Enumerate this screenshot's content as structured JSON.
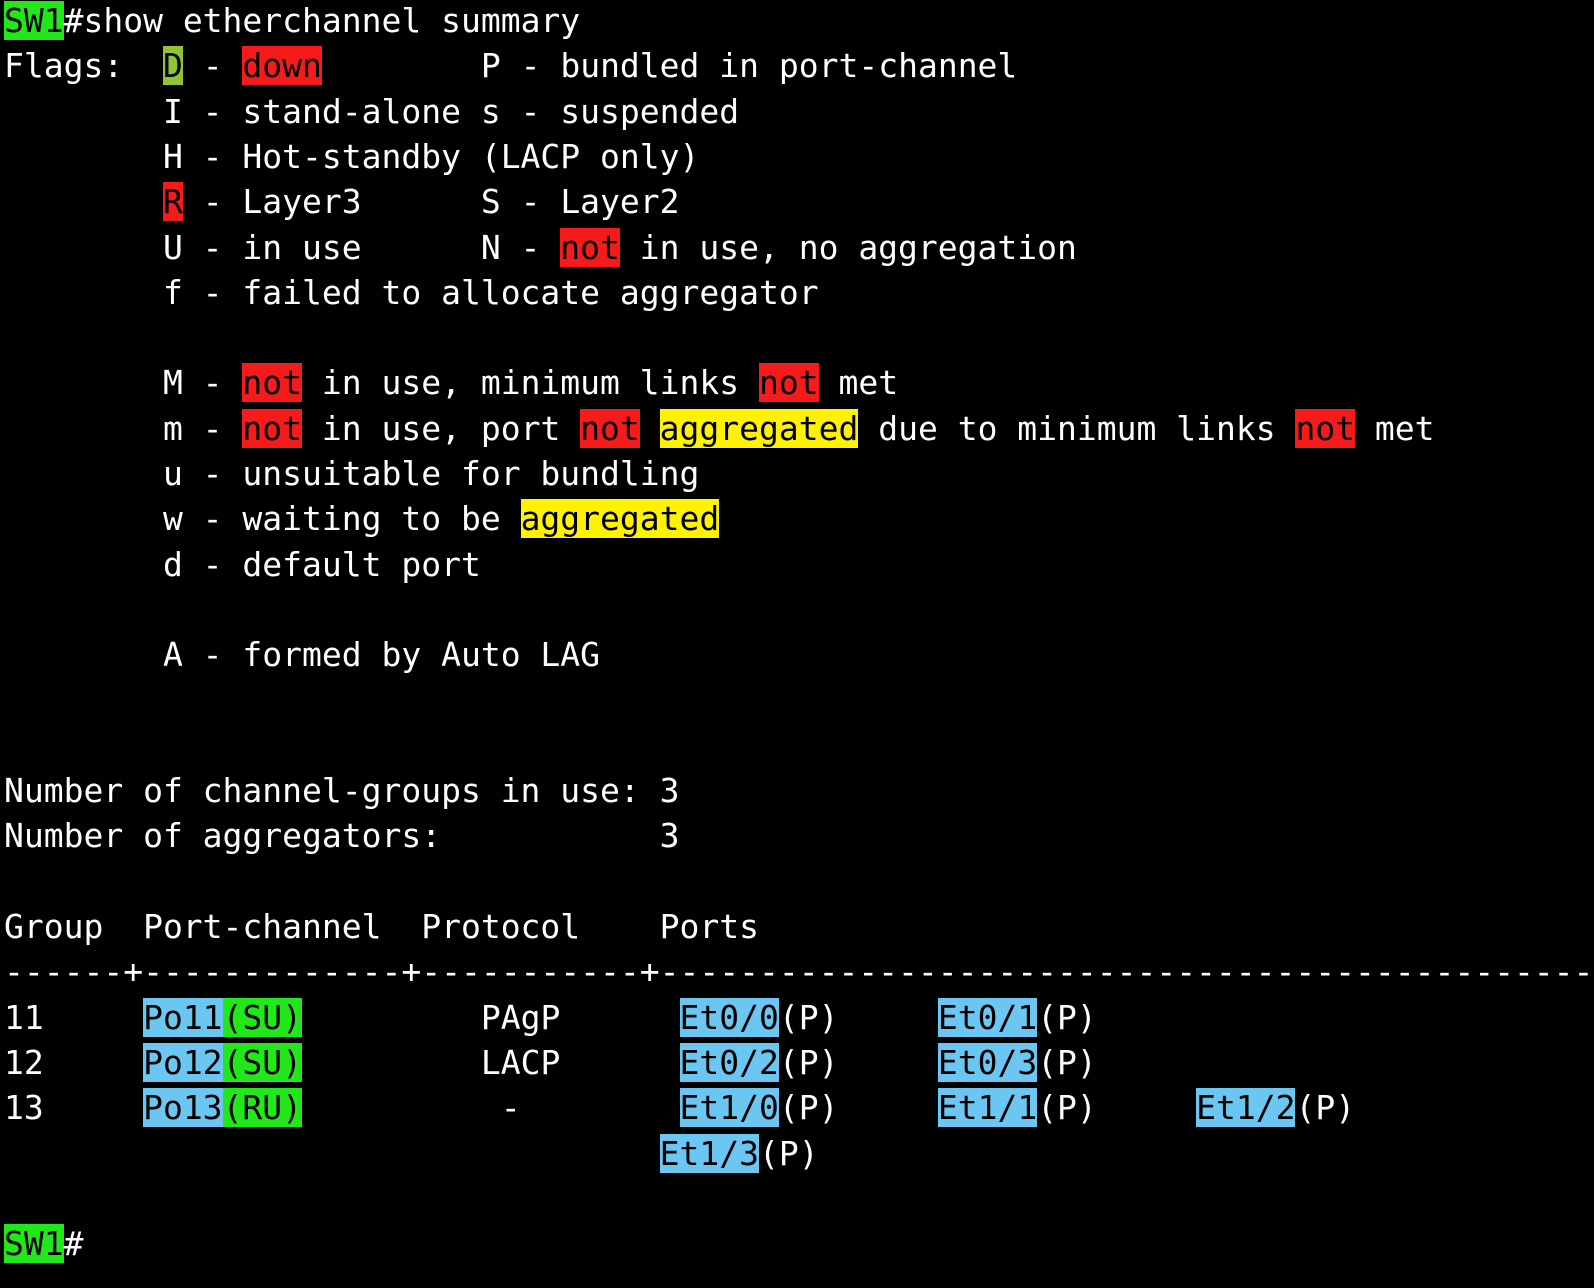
{
  "terminal": {
    "background": "#000000",
    "foreground": "#ffffff",
    "highlight_colors": {
      "green": "#22e81b",
      "olive": "#8fc435",
      "red": "#f51b1b",
      "yellow": "#fdf200",
      "blue": "#6bc7f2"
    },
    "lines": [
      {
        "name": "command-line",
        "segments": [
          {
            "t": "SW1",
            "hl": "green"
          },
          {
            "t": "#show etherchannel summary"
          }
        ]
      },
      {
        "name": "flags-line",
        "segments": [
          {
            "t": "Flags:  "
          },
          {
            "t": "D",
            "hl": "olive"
          },
          {
            "t": " - "
          },
          {
            "t": "down",
            "hl": "red"
          },
          {
            "t": "        P - bundled in port-channel"
          }
        ]
      },
      {
        "name": "flags-line",
        "segments": [
          {
            "t": "        I - stand-alone s - suspended"
          }
        ]
      },
      {
        "name": "flags-line",
        "segments": [
          {
            "t": "        H - Hot-standby (LACP only)"
          }
        ]
      },
      {
        "name": "flags-line",
        "segments": [
          {
            "t": "        "
          },
          {
            "t": "R",
            "hl": "red"
          },
          {
            "t": " - Layer3      S - Layer2"
          }
        ]
      },
      {
        "name": "flags-line",
        "segments": [
          {
            "t": "        U - in use      N - "
          },
          {
            "t": "not",
            "hl": "red"
          },
          {
            "t": " in use, no aggregation"
          }
        ]
      },
      {
        "name": "flags-line",
        "segments": [
          {
            "t": "        f - failed to allocate aggregator"
          }
        ]
      },
      {
        "name": "blank-line",
        "segments": []
      },
      {
        "name": "flags-line",
        "segments": [
          {
            "t": "        M - "
          },
          {
            "t": "not",
            "hl": "red"
          },
          {
            "t": " in use, minimum links "
          },
          {
            "t": "not",
            "hl": "red"
          },
          {
            "t": " met"
          }
        ]
      },
      {
        "name": "flags-line",
        "segments": [
          {
            "t": "        m - "
          },
          {
            "t": "not",
            "hl": "red"
          },
          {
            "t": " in use, port "
          },
          {
            "t": "not",
            "hl": "red"
          },
          {
            "t": " "
          },
          {
            "t": "aggregated",
            "hl": "yellow"
          },
          {
            "t": " due to minimum links "
          },
          {
            "t": "not",
            "hl": "red"
          },
          {
            "t": " met"
          }
        ]
      },
      {
        "name": "flags-line",
        "segments": [
          {
            "t": "        u - unsuitable for bundling"
          }
        ]
      },
      {
        "name": "flags-line",
        "segments": [
          {
            "t": "        w - waiting to be "
          },
          {
            "t": "aggregated",
            "hl": "yellow"
          }
        ]
      },
      {
        "name": "flags-line",
        "segments": [
          {
            "t": "        d - default port"
          }
        ]
      },
      {
        "name": "blank-line",
        "segments": []
      },
      {
        "name": "flags-line",
        "segments": [
          {
            "t": "        A - formed by Auto LAG"
          }
        ]
      },
      {
        "name": "blank-line",
        "segments": []
      },
      {
        "name": "blank-line",
        "segments": []
      },
      {
        "name": "summary-line",
        "segments": [
          {
            "t": "Number of channel-groups in use: 3"
          }
        ]
      },
      {
        "name": "summary-line",
        "segments": [
          {
            "t": "Number of aggregators:           3"
          }
        ]
      },
      {
        "name": "blank-line",
        "segments": []
      },
      {
        "name": "table-header",
        "segments": [
          {
            "t": "Group  Port-channel  Protocol    Ports"
          }
        ]
      },
      {
        "name": "table-divider",
        "segments": [
          {
            "t": "------+-------------+-----------+-----------------------------------------------"
          }
        ]
      },
      {
        "name": "table-row",
        "segments": [
          {
            "t": "11     "
          },
          {
            "t": "Po11",
            "hl": "blue"
          },
          {
            "t": "(SU)",
            "hl": "green"
          },
          {
            "t": "         PAgP      "
          },
          {
            "t": "Et0/0",
            "hl": "blue"
          },
          {
            "t": "(P)     "
          },
          {
            "t": "Et0/1",
            "hl": "blue"
          },
          {
            "t": "(P)"
          }
        ]
      },
      {
        "name": "table-row",
        "segments": [
          {
            "t": "12     "
          },
          {
            "t": "Po12",
            "hl": "blue"
          },
          {
            "t": "(SU)",
            "hl": "green"
          },
          {
            "t": "         LACP      "
          },
          {
            "t": "Et0/2",
            "hl": "blue"
          },
          {
            "t": "(P)     "
          },
          {
            "t": "Et0/3",
            "hl": "blue"
          },
          {
            "t": "(P)"
          }
        ]
      },
      {
        "name": "table-row",
        "segments": [
          {
            "t": "13     "
          },
          {
            "t": "Po13",
            "hl": "blue"
          },
          {
            "t": "(RU)",
            "hl": "green"
          },
          {
            "t": "          -        "
          },
          {
            "t": "Et1/0",
            "hl": "blue"
          },
          {
            "t": "(P)     "
          },
          {
            "t": "Et1/1",
            "hl": "blue"
          },
          {
            "t": "(P)     "
          },
          {
            "t": "Et1/2",
            "hl": "blue"
          },
          {
            "t": "(P)"
          }
        ]
      },
      {
        "name": "table-row-continuation",
        "segments": [
          {
            "t": "                                 "
          },
          {
            "t": "Et1/3",
            "hl": "blue"
          },
          {
            "t": "(P)"
          }
        ]
      },
      {
        "name": "blank-line",
        "segments": []
      },
      {
        "name": "prompt-line",
        "segments": [
          {
            "t": "SW1",
            "hl": "green"
          },
          {
            "t": "#"
          }
        ]
      }
    ]
  }
}
